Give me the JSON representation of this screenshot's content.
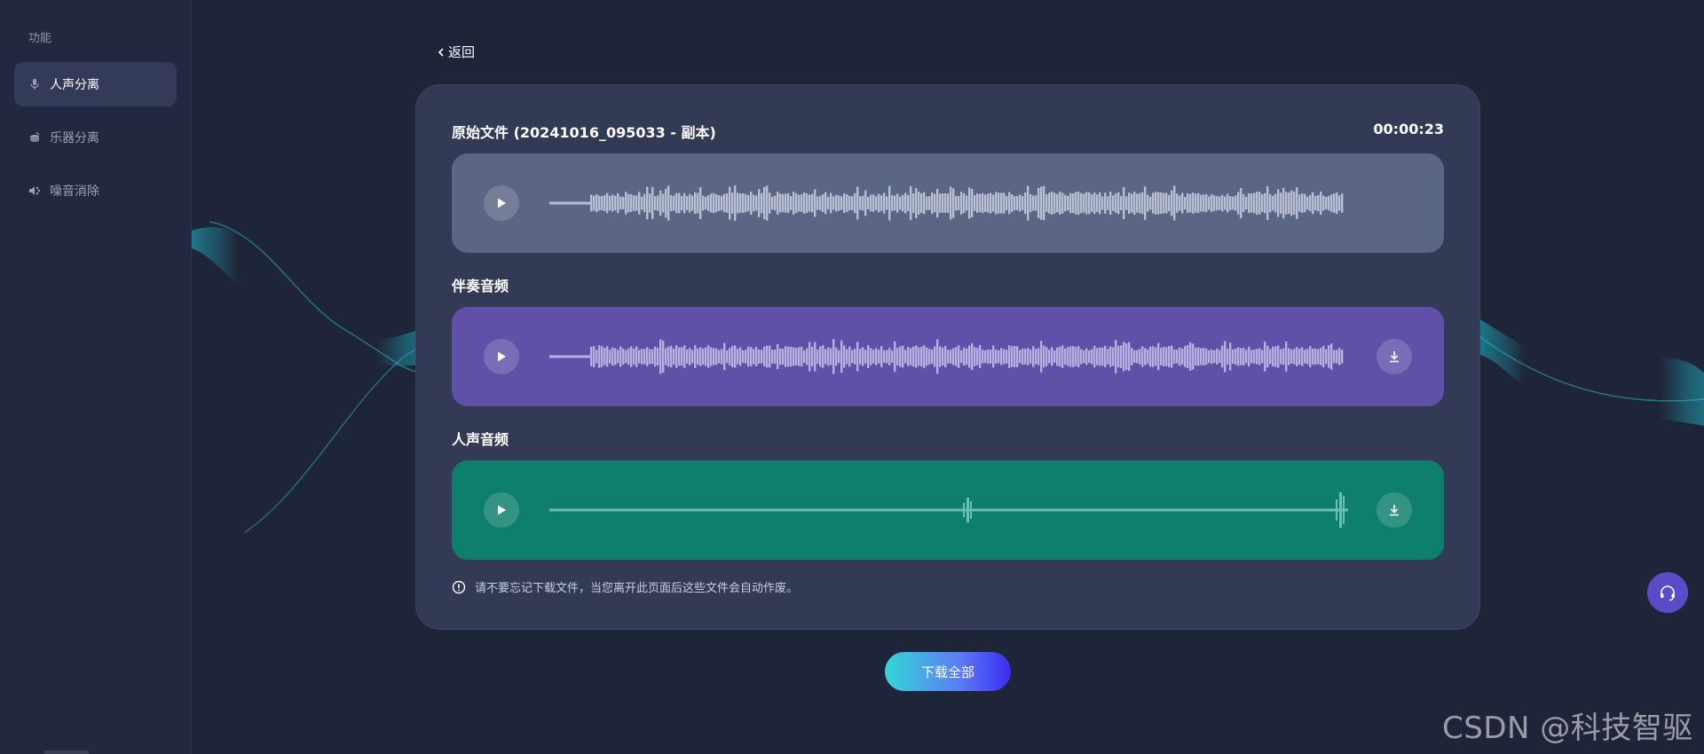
{
  "sidebar": {
    "section_title": "功能",
    "items": [
      {
        "label": "人声分离",
        "icon": "microphone-icon",
        "active": true
      },
      {
        "label": "乐器分离",
        "icon": "drum-icon",
        "active": false
      },
      {
        "label": "噪音消除",
        "icon": "speaker-noise-icon",
        "active": false
      }
    ]
  },
  "back": {
    "label": "返回",
    "icon": "chevron-left-icon"
  },
  "tracks": {
    "original": {
      "title": "原始文件 (20241016_095033 - 副本)",
      "duration": "00:00:23",
      "color": "#5b6584"
    },
    "accompaniment": {
      "title": "伴奏音频",
      "color": "#6150a8"
    },
    "vocals": {
      "title": "人声音频",
      "color": "#0e7f6c"
    }
  },
  "notice": {
    "text": "请不要忘记下载文件，当您离开此页面后这些文件会自动作废。",
    "icon": "info-circle-icon"
  },
  "download_all": {
    "label": "下载全部"
  },
  "support": {
    "icon": "headset-icon",
    "color": "#5b4bc9"
  },
  "watermark": {
    "text": "CSDN @科技智驱"
  },
  "colors": {
    "background": "#1f2538",
    "sidebar": "#232841",
    "card": "#333a55",
    "accent": "#5b4bc9"
  }
}
